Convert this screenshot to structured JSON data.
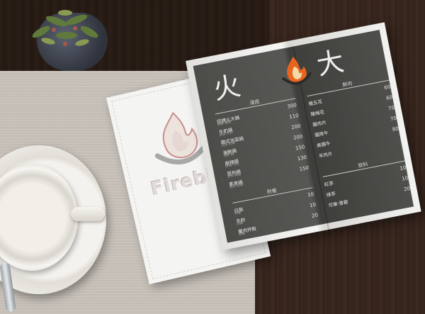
{
  "brand": {
    "name": "Firebig",
    "title_left": "火",
    "title_right": "大"
  },
  "colors": {
    "menu_dark": "#4c4c49",
    "menu_white": "#f4f4f2",
    "flame_orange": "#e8641f",
    "flame_cream": "#f2d9a6",
    "bowl_dark": "#2b2b2b"
  },
  "menu": {
    "left": {
      "section1": {
        "title": "湯底",
        "items": [
          {
            "name": "招牌火大鍋",
            "desc": "麻辣·香辣",
            "price": "300"
          },
          {
            "name": "牛奶鍋",
            "desc": "蔬菜·牛奶",
            "price": "110"
          },
          {
            "name": "韓式泡菜鍋",
            "desc": "泡菜·豆腐",
            "price": "200"
          },
          {
            "name": "海鮮鍋",
            "desc": "海鮮·蝦",
            "price": "200"
          },
          {
            "name": "麻辣鍋",
            "desc": "麻辣·牛肉",
            "price": "150"
          },
          {
            "name": "昆布鍋",
            "desc": "昆布·蔬菜",
            "price": "130"
          },
          {
            "name": "素食鍋",
            "desc": "蔬菜·菇類",
            "price": "150"
          }
        ]
      },
      "section2": {
        "title": "附餐",
        "items": [
          {
            "name": "白飯",
            "desc": "附餐",
            "price": "10"
          },
          {
            "name": "冬粉",
            "desc": "附餐",
            "price": "10"
          },
          {
            "name": "羹肉拌飯",
            "desc": "附餐",
            "price": "20"
          }
        ]
      }
    },
    "right": {
      "section1": {
        "title": "鮮肉",
        "items": [
          {
            "name": "豬五花",
            "desc": "",
            "price": "60"
          },
          {
            "name": "豬梅花",
            "desc": "",
            "price": "60"
          },
          {
            "name": "雞肉片",
            "desc": "",
            "price": "70"
          },
          {
            "name": "霜降牛",
            "desc": "",
            "price": "70"
          },
          {
            "name": "美國牛",
            "desc": "",
            "price": "80"
          },
          {
            "name": "羊肉片",
            "desc": "",
            "price": ""
          }
        ]
      },
      "section2": {
        "title": "飲料",
        "items": [
          {
            "name": "紅茶",
            "desc": "",
            "price": "10"
          },
          {
            "name": "綠茶",
            "desc": "",
            "price": "10"
          },
          {
            "name": "可樂·雪碧",
            "desc": "",
            "price": "20"
          }
        ]
      }
    }
  }
}
